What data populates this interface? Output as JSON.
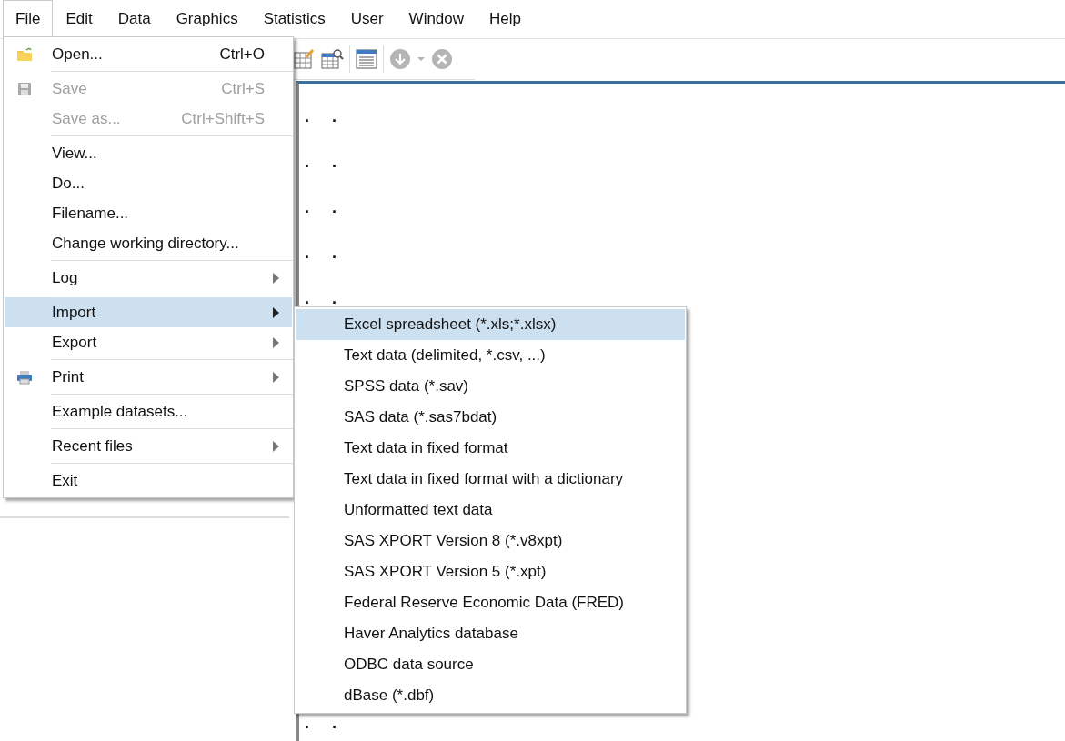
{
  "menubar": [
    {
      "label": "File",
      "selected": true
    },
    {
      "label": "Edit",
      "selected": false
    },
    {
      "label": "Data",
      "selected": false
    },
    {
      "label": "Graphics",
      "selected": false
    },
    {
      "label": "Statistics",
      "selected": false
    },
    {
      "label": "User",
      "selected": false
    },
    {
      "label": "Window",
      "selected": false
    },
    {
      "label": "Help",
      "selected": false
    }
  ],
  "results": {
    "prompt_lines_top": [
      ". .",
      ". .",
      ". .",
      ". .",
      ". ."
    ],
    "prompt_lines_bottom": [
      ". ."
    ]
  },
  "file_menu": [
    {
      "kind": "item",
      "label": "Open...",
      "shortcut": "Ctrl+O",
      "disabled": false,
      "submenu": false,
      "selected": false
    },
    {
      "kind": "separator"
    },
    {
      "kind": "item",
      "label": "Save",
      "shortcut": "Ctrl+S",
      "disabled": true,
      "submenu": false,
      "selected": false
    },
    {
      "kind": "item",
      "label": "Save as...",
      "shortcut": "Ctrl+Shift+S",
      "disabled": true,
      "submenu": false,
      "selected": false
    },
    {
      "kind": "separator"
    },
    {
      "kind": "item",
      "label": "View...",
      "disabled": false,
      "submenu": false,
      "selected": false
    },
    {
      "kind": "item",
      "label": "Do...",
      "disabled": false,
      "submenu": false,
      "selected": false
    },
    {
      "kind": "item",
      "label": "Filename...",
      "disabled": false,
      "submenu": false,
      "selected": false
    },
    {
      "kind": "item",
      "label": "Change working directory...",
      "disabled": false,
      "submenu": false,
      "selected": false
    },
    {
      "kind": "separator"
    },
    {
      "kind": "item",
      "label": "Log",
      "disabled": false,
      "submenu": true,
      "selected": false
    },
    {
      "kind": "separator"
    },
    {
      "kind": "item",
      "label": "Import",
      "disabled": false,
      "submenu": true,
      "selected": true
    },
    {
      "kind": "item",
      "label": "Export",
      "disabled": false,
      "submenu": true,
      "selected": false
    },
    {
      "kind": "separator"
    },
    {
      "kind": "item",
      "label": "Print",
      "disabled": false,
      "submenu": true,
      "selected": false
    },
    {
      "kind": "separator"
    },
    {
      "kind": "item",
      "label": "Example datasets...",
      "disabled": false,
      "submenu": false,
      "selected": false
    },
    {
      "kind": "separator"
    },
    {
      "kind": "item",
      "label": "Recent files",
      "disabled": false,
      "submenu": true,
      "selected": false
    },
    {
      "kind": "separator"
    },
    {
      "kind": "item",
      "label": "Exit",
      "disabled": false,
      "submenu": false,
      "selected": false
    }
  ],
  "import_menu": [
    {
      "label": "Excel spreadsheet (*.xls;*.xlsx)",
      "selected": true
    },
    {
      "label": "Text data (delimited, *.csv, ...)",
      "selected": false
    },
    {
      "label": "SPSS data (*.sav)",
      "selected": false
    },
    {
      "label": "SAS data (*.sas7bdat)",
      "selected": false
    },
    {
      "label": "Text data in fixed format",
      "selected": false
    },
    {
      "label": "Text data in fixed format with a dictionary",
      "selected": false
    },
    {
      "label": "Unformatted text data",
      "selected": false
    },
    {
      "label": "SAS XPORT Version 8 (*.v8xpt)",
      "selected": false
    },
    {
      "label": "SAS XPORT Version 5 (*.xpt)",
      "selected": false
    },
    {
      "label": "Federal Reserve Economic Data (FRED)",
      "selected": false
    },
    {
      "label": "Haver Analytics database",
      "selected": false
    },
    {
      "label": "ODBC data source",
      "selected": false
    },
    {
      "label": "dBase (*.dbf)",
      "selected": false
    }
  ]
}
